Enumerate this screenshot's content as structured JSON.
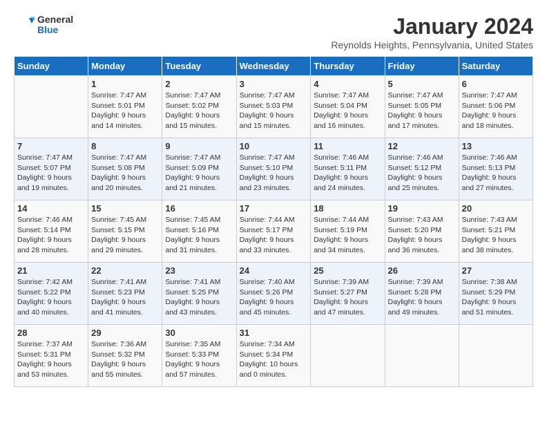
{
  "logo": {
    "text_general": "General",
    "text_blue": "Blue"
  },
  "title": "January 2024",
  "subtitle": "Reynolds Heights, Pennsylvania, United States",
  "weekdays": [
    "Sunday",
    "Monday",
    "Tuesday",
    "Wednesday",
    "Thursday",
    "Friday",
    "Saturday"
  ],
  "weeks": [
    [
      {
        "day": "",
        "info": ""
      },
      {
        "day": "1",
        "info": "Sunrise: 7:47 AM\nSunset: 5:01 PM\nDaylight: 9 hours\nand 14 minutes."
      },
      {
        "day": "2",
        "info": "Sunrise: 7:47 AM\nSunset: 5:02 PM\nDaylight: 9 hours\nand 15 minutes."
      },
      {
        "day": "3",
        "info": "Sunrise: 7:47 AM\nSunset: 5:03 PM\nDaylight: 9 hours\nand 15 minutes."
      },
      {
        "day": "4",
        "info": "Sunrise: 7:47 AM\nSunset: 5:04 PM\nDaylight: 9 hours\nand 16 minutes."
      },
      {
        "day": "5",
        "info": "Sunrise: 7:47 AM\nSunset: 5:05 PM\nDaylight: 9 hours\nand 17 minutes."
      },
      {
        "day": "6",
        "info": "Sunrise: 7:47 AM\nSunset: 5:06 PM\nDaylight: 9 hours\nand 18 minutes."
      }
    ],
    [
      {
        "day": "7",
        "info": "Sunrise: 7:47 AM\nSunset: 5:07 PM\nDaylight: 9 hours\nand 19 minutes."
      },
      {
        "day": "8",
        "info": "Sunrise: 7:47 AM\nSunset: 5:08 PM\nDaylight: 9 hours\nand 20 minutes."
      },
      {
        "day": "9",
        "info": "Sunrise: 7:47 AM\nSunset: 5:09 PM\nDaylight: 9 hours\nand 21 minutes."
      },
      {
        "day": "10",
        "info": "Sunrise: 7:47 AM\nSunset: 5:10 PM\nDaylight: 9 hours\nand 23 minutes."
      },
      {
        "day": "11",
        "info": "Sunrise: 7:46 AM\nSunset: 5:11 PM\nDaylight: 9 hours\nand 24 minutes."
      },
      {
        "day": "12",
        "info": "Sunrise: 7:46 AM\nSunset: 5:12 PM\nDaylight: 9 hours\nand 25 minutes."
      },
      {
        "day": "13",
        "info": "Sunrise: 7:46 AM\nSunset: 5:13 PM\nDaylight: 9 hours\nand 27 minutes."
      }
    ],
    [
      {
        "day": "14",
        "info": "Sunrise: 7:46 AM\nSunset: 5:14 PM\nDaylight: 9 hours\nand 28 minutes."
      },
      {
        "day": "15",
        "info": "Sunrise: 7:45 AM\nSunset: 5:15 PM\nDaylight: 9 hours\nand 29 minutes."
      },
      {
        "day": "16",
        "info": "Sunrise: 7:45 AM\nSunset: 5:16 PM\nDaylight: 9 hours\nand 31 minutes."
      },
      {
        "day": "17",
        "info": "Sunrise: 7:44 AM\nSunset: 5:17 PM\nDaylight: 9 hours\nand 33 minutes."
      },
      {
        "day": "18",
        "info": "Sunrise: 7:44 AM\nSunset: 5:19 PM\nDaylight: 9 hours\nand 34 minutes."
      },
      {
        "day": "19",
        "info": "Sunrise: 7:43 AM\nSunset: 5:20 PM\nDaylight: 9 hours\nand 36 minutes."
      },
      {
        "day": "20",
        "info": "Sunrise: 7:43 AM\nSunset: 5:21 PM\nDaylight: 9 hours\nand 38 minutes."
      }
    ],
    [
      {
        "day": "21",
        "info": "Sunrise: 7:42 AM\nSunset: 5:22 PM\nDaylight: 9 hours\nand 40 minutes."
      },
      {
        "day": "22",
        "info": "Sunrise: 7:41 AM\nSunset: 5:23 PM\nDaylight: 9 hours\nand 41 minutes."
      },
      {
        "day": "23",
        "info": "Sunrise: 7:41 AM\nSunset: 5:25 PM\nDaylight: 9 hours\nand 43 minutes."
      },
      {
        "day": "24",
        "info": "Sunrise: 7:40 AM\nSunset: 5:26 PM\nDaylight: 9 hours\nand 45 minutes."
      },
      {
        "day": "25",
        "info": "Sunrise: 7:39 AM\nSunset: 5:27 PM\nDaylight: 9 hours\nand 47 minutes."
      },
      {
        "day": "26",
        "info": "Sunrise: 7:39 AM\nSunset: 5:28 PM\nDaylight: 9 hours\nand 49 minutes."
      },
      {
        "day": "27",
        "info": "Sunrise: 7:38 AM\nSunset: 5:29 PM\nDaylight: 9 hours\nand 51 minutes."
      }
    ],
    [
      {
        "day": "28",
        "info": "Sunrise: 7:37 AM\nSunset: 5:31 PM\nDaylight: 9 hours\nand 53 minutes."
      },
      {
        "day": "29",
        "info": "Sunrise: 7:36 AM\nSunset: 5:32 PM\nDaylight: 9 hours\nand 55 minutes."
      },
      {
        "day": "30",
        "info": "Sunrise: 7:35 AM\nSunset: 5:33 PM\nDaylight: 9 hours\nand 57 minutes."
      },
      {
        "day": "31",
        "info": "Sunrise: 7:34 AM\nSunset: 5:34 PM\nDaylight: 10 hours\nand 0 minutes."
      },
      {
        "day": "",
        "info": ""
      },
      {
        "day": "",
        "info": ""
      },
      {
        "day": "",
        "info": ""
      }
    ]
  ]
}
